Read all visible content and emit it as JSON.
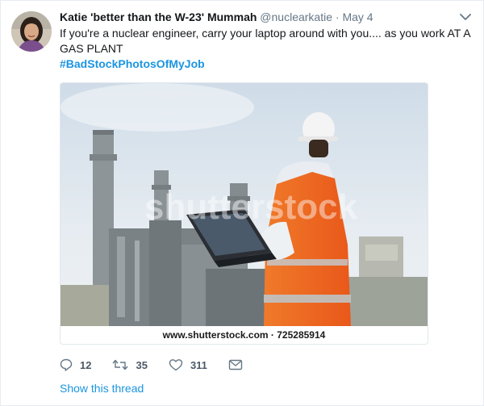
{
  "tweet": {
    "display_name": "Katie 'better than the W-23' Mummah",
    "handle": "@nuclearkatie",
    "separator": "·",
    "date": "May 4",
    "text": "If you're a nuclear engineer, carry your laptop around with you.... as you work AT A GAS PLANT",
    "hashtag": "#BadStockPhotosOfMyJob",
    "media": {
      "watermark_text": "shutterstock",
      "stock_caption": "www.shutterstock.com · 725285914"
    },
    "actions": {
      "reply_count": "12",
      "retweet_count": "35",
      "like_count": "311"
    },
    "show_thread_label": "Show this thread",
    "colors": {
      "link": "#1b95e0",
      "secondary_text": "#657786",
      "vest": "#f26a1b",
      "sky": "#dfe7ef"
    },
    "icons": [
      "chevron-down-icon",
      "reply-icon",
      "retweet-icon",
      "like-icon",
      "direct-message-icon"
    ]
  }
}
